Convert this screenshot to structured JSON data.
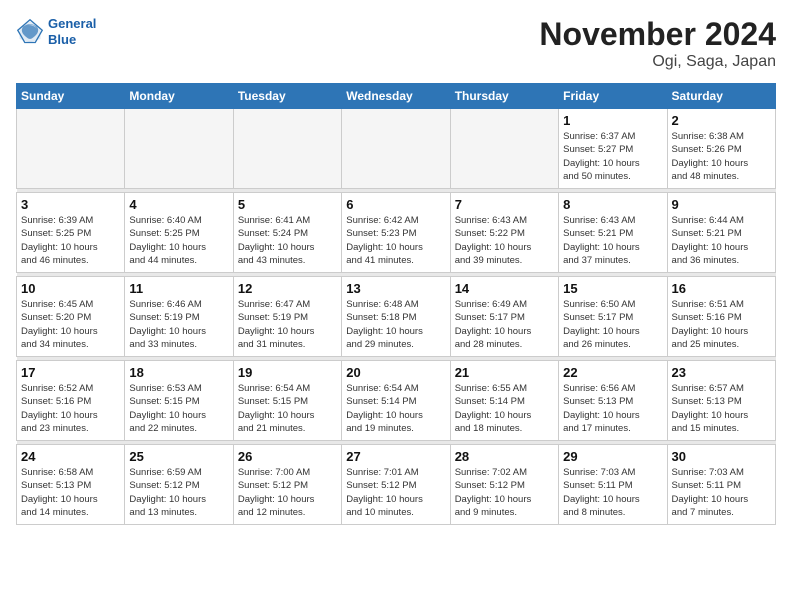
{
  "header": {
    "logo_line1": "General",
    "logo_line2": "Blue",
    "month": "November 2024",
    "location": "Ogi, Saga, Japan"
  },
  "weekdays": [
    "Sunday",
    "Monday",
    "Tuesday",
    "Wednesday",
    "Thursday",
    "Friday",
    "Saturday"
  ],
  "weeks": [
    [
      {
        "day": "",
        "info": ""
      },
      {
        "day": "",
        "info": ""
      },
      {
        "day": "",
        "info": ""
      },
      {
        "day": "",
        "info": ""
      },
      {
        "day": "",
        "info": ""
      },
      {
        "day": "1",
        "info": "Sunrise: 6:37 AM\nSunset: 5:27 PM\nDaylight: 10 hours\nand 50 minutes."
      },
      {
        "day": "2",
        "info": "Sunrise: 6:38 AM\nSunset: 5:26 PM\nDaylight: 10 hours\nand 48 minutes."
      }
    ],
    [
      {
        "day": "3",
        "info": "Sunrise: 6:39 AM\nSunset: 5:25 PM\nDaylight: 10 hours\nand 46 minutes."
      },
      {
        "day": "4",
        "info": "Sunrise: 6:40 AM\nSunset: 5:25 PM\nDaylight: 10 hours\nand 44 minutes."
      },
      {
        "day": "5",
        "info": "Sunrise: 6:41 AM\nSunset: 5:24 PM\nDaylight: 10 hours\nand 43 minutes."
      },
      {
        "day": "6",
        "info": "Sunrise: 6:42 AM\nSunset: 5:23 PM\nDaylight: 10 hours\nand 41 minutes."
      },
      {
        "day": "7",
        "info": "Sunrise: 6:43 AM\nSunset: 5:22 PM\nDaylight: 10 hours\nand 39 minutes."
      },
      {
        "day": "8",
        "info": "Sunrise: 6:43 AM\nSunset: 5:21 PM\nDaylight: 10 hours\nand 37 minutes."
      },
      {
        "day": "9",
        "info": "Sunrise: 6:44 AM\nSunset: 5:21 PM\nDaylight: 10 hours\nand 36 minutes."
      }
    ],
    [
      {
        "day": "10",
        "info": "Sunrise: 6:45 AM\nSunset: 5:20 PM\nDaylight: 10 hours\nand 34 minutes."
      },
      {
        "day": "11",
        "info": "Sunrise: 6:46 AM\nSunset: 5:19 PM\nDaylight: 10 hours\nand 33 minutes."
      },
      {
        "day": "12",
        "info": "Sunrise: 6:47 AM\nSunset: 5:19 PM\nDaylight: 10 hours\nand 31 minutes."
      },
      {
        "day": "13",
        "info": "Sunrise: 6:48 AM\nSunset: 5:18 PM\nDaylight: 10 hours\nand 29 minutes."
      },
      {
        "day": "14",
        "info": "Sunrise: 6:49 AM\nSunset: 5:17 PM\nDaylight: 10 hours\nand 28 minutes."
      },
      {
        "day": "15",
        "info": "Sunrise: 6:50 AM\nSunset: 5:17 PM\nDaylight: 10 hours\nand 26 minutes."
      },
      {
        "day": "16",
        "info": "Sunrise: 6:51 AM\nSunset: 5:16 PM\nDaylight: 10 hours\nand 25 minutes."
      }
    ],
    [
      {
        "day": "17",
        "info": "Sunrise: 6:52 AM\nSunset: 5:16 PM\nDaylight: 10 hours\nand 23 minutes."
      },
      {
        "day": "18",
        "info": "Sunrise: 6:53 AM\nSunset: 5:15 PM\nDaylight: 10 hours\nand 22 minutes."
      },
      {
        "day": "19",
        "info": "Sunrise: 6:54 AM\nSunset: 5:15 PM\nDaylight: 10 hours\nand 21 minutes."
      },
      {
        "day": "20",
        "info": "Sunrise: 6:54 AM\nSunset: 5:14 PM\nDaylight: 10 hours\nand 19 minutes."
      },
      {
        "day": "21",
        "info": "Sunrise: 6:55 AM\nSunset: 5:14 PM\nDaylight: 10 hours\nand 18 minutes."
      },
      {
        "day": "22",
        "info": "Sunrise: 6:56 AM\nSunset: 5:13 PM\nDaylight: 10 hours\nand 17 minutes."
      },
      {
        "day": "23",
        "info": "Sunrise: 6:57 AM\nSunset: 5:13 PM\nDaylight: 10 hours\nand 15 minutes."
      }
    ],
    [
      {
        "day": "24",
        "info": "Sunrise: 6:58 AM\nSunset: 5:13 PM\nDaylight: 10 hours\nand 14 minutes."
      },
      {
        "day": "25",
        "info": "Sunrise: 6:59 AM\nSunset: 5:12 PM\nDaylight: 10 hours\nand 13 minutes."
      },
      {
        "day": "26",
        "info": "Sunrise: 7:00 AM\nSunset: 5:12 PM\nDaylight: 10 hours\nand 12 minutes."
      },
      {
        "day": "27",
        "info": "Sunrise: 7:01 AM\nSunset: 5:12 PM\nDaylight: 10 hours\nand 10 minutes."
      },
      {
        "day": "28",
        "info": "Sunrise: 7:02 AM\nSunset: 5:12 PM\nDaylight: 10 hours\nand 9 minutes."
      },
      {
        "day": "29",
        "info": "Sunrise: 7:03 AM\nSunset: 5:11 PM\nDaylight: 10 hours\nand 8 minutes."
      },
      {
        "day": "30",
        "info": "Sunrise: 7:03 AM\nSunset: 5:11 PM\nDaylight: 10 hours\nand 7 minutes."
      }
    ]
  ]
}
